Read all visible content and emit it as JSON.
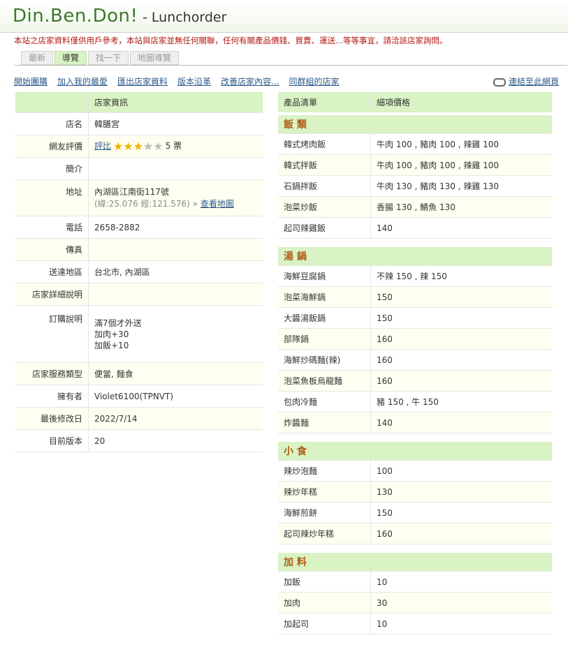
{
  "header": {
    "logo": "Din.Ben.Don!",
    "subtitle": "- Lunchorder",
    "notice": "本站之店家資料僅供用戶參考，本站與店家並無任何關聯，任何有關產品價錢、買賣、運送...等等事宜，請洽該店家詢問。"
  },
  "tabs": [
    "最新",
    "導覽",
    "找一下",
    "地圖導覽"
  ],
  "links": {
    "items": [
      "開始團購",
      "加入我的最愛",
      "匯出店家資料",
      "版本沿革",
      "改善店家內容...",
      "同群組的店家"
    ],
    "link_here": "連結至此網頁"
  },
  "info": {
    "header": "店家資訊",
    "rows": [
      {
        "k": "店名",
        "v": "韓膳宮"
      },
      {
        "k": "網友評價",
        "rate_label": "評比",
        "stars": 3,
        "votes": "5 票"
      },
      {
        "k": "簡介",
        "v": ""
      },
      {
        "k": "地址",
        "v": "內湖區江南街117號",
        "coords": "(緯:25.076 經:121.576) »",
        "map": "查看地圖"
      },
      {
        "k": "電話",
        "v": "2658-2882"
      },
      {
        "k": "傳真",
        "v": ""
      },
      {
        "k": "送達地區",
        "v": "台北市, 內湖區"
      },
      {
        "k": "店家詳細說明",
        "v": ""
      },
      {
        "k": "訂購說明",
        "lines": [
          "滿7個才外送",
          "加肉+30",
          "加飯+10"
        ]
      },
      {
        "k": "店家服務類型",
        "v": "便當, 麵食"
      },
      {
        "k": "擁有者",
        "v": "Violet6100(TPNVT)"
      },
      {
        "k": "最後修改日",
        "v": "2022/7/14"
      },
      {
        "k": "目前版本",
        "v": "20"
      }
    ]
  },
  "products": {
    "col1": "產品清單",
    "col2": "細項價格",
    "categories": [
      {
        "name": "飯 類",
        "items": [
          [
            "韓式烤肉飯",
            "牛肉 100 , 豬肉 100 , 辣雞 100"
          ],
          [
            "韓式拌飯",
            "牛肉 100 , 豬肉 100 , 辣雞 100"
          ],
          [
            "石鍋拌飯",
            "牛肉 130 , 豬肉 130 , 辣雞 130"
          ],
          [
            "泡菜炒飯",
            "香腸 130 , 鯖魚 130"
          ],
          [
            "起司辣雞飯",
            "140"
          ]
        ]
      },
      {
        "name": "湯 鍋",
        "items": [
          [
            "海鮮豆腐鍋",
            "不辣 150 , 辣 150"
          ],
          [
            "泡菜海鮮鍋",
            "150"
          ],
          [
            "大醬湯飯鍋",
            "150"
          ],
          [
            "部隊鍋",
            "160"
          ],
          [
            "海鮮炒碼麵(辣)",
            "160"
          ],
          [
            "泡菜魚板烏龍麵",
            "160"
          ],
          [
            "包肉冷麵",
            "豬 150 , 牛 150"
          ],
          [
            "炸醬麵",
            "140"
          ]
        ]
      },
      {
        "name": "小 食",
        "items": [
          [
            "辣炒泡麵",
            "100"
          ],
          [
            "辣炒年糕",
            "130"
          ],
          [
            "海鮮煎餅",
            "150"
          ],
          [
            "起司辣炒年糕",
            "160"
          ]
        ]
      },
      {
        "name": "加 料",
        "items": [
          [
            "加飯",
            "10"
          ],
          [
            "加肉",
            "30"
          ],
          [
            "加起司",
            "10"
          ]
        ]
      }
    ]
  },
  "colors": {
    "logo": "#3d7a2b",
    "notice": "#b0170f",
    "accent": "#d9f3c4",
    "category": "#b05a12",
    "link": "#2c5a8a"
  }
}
